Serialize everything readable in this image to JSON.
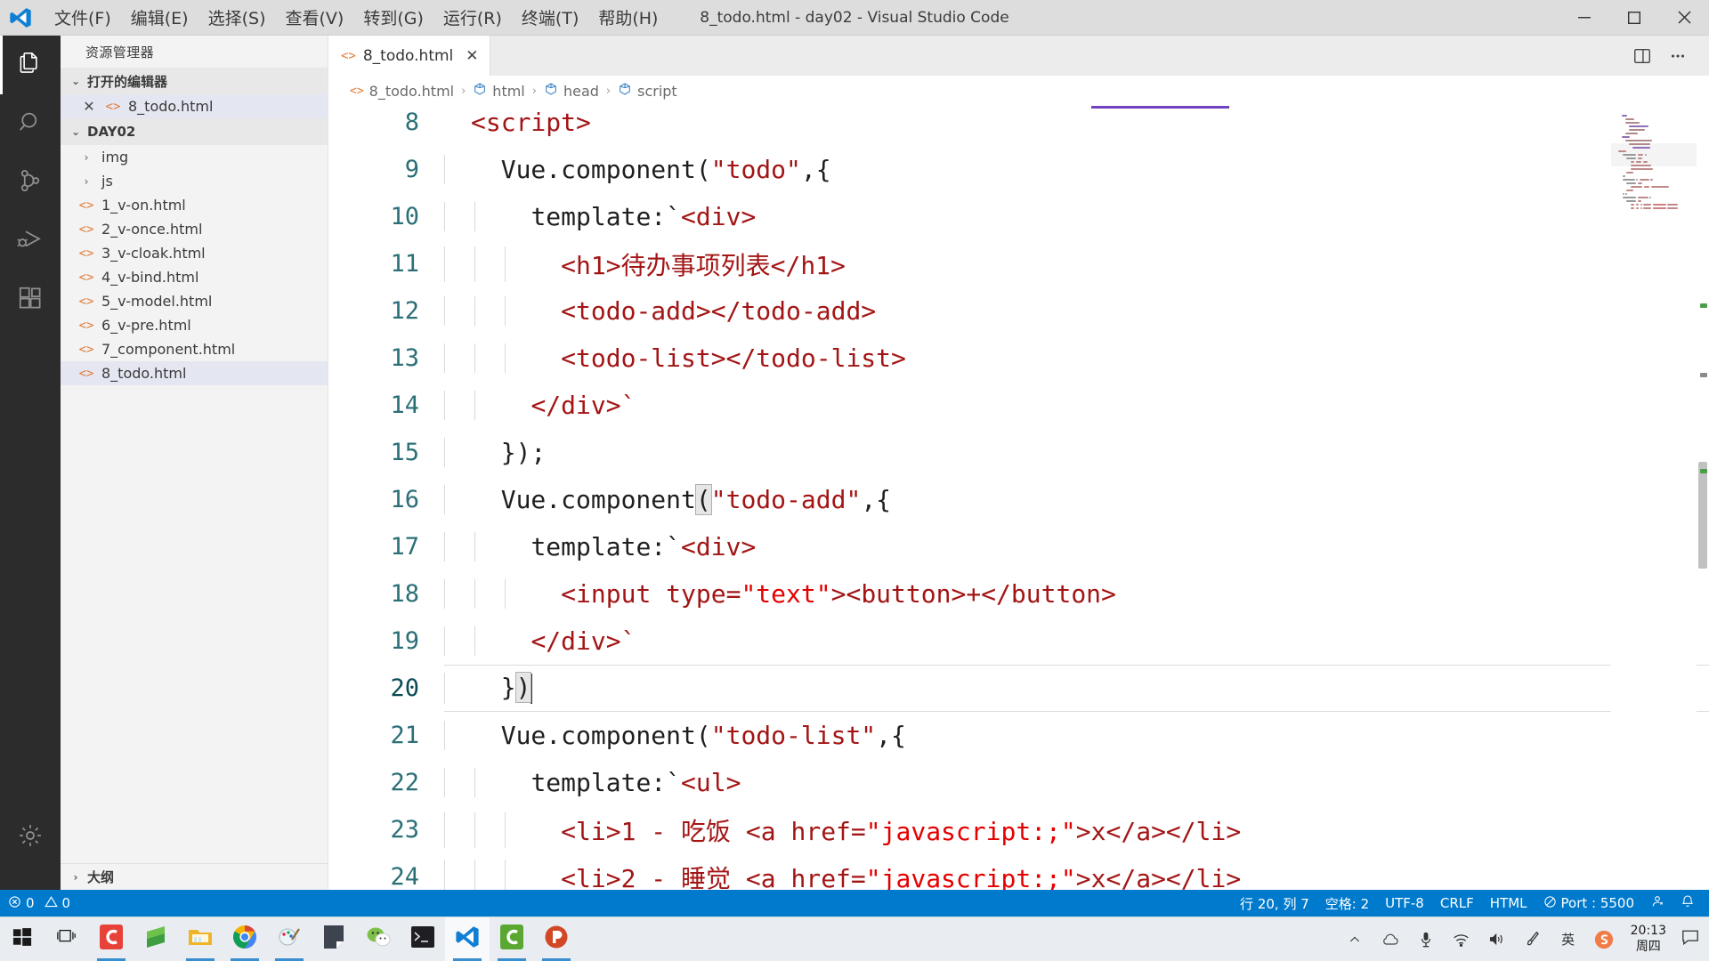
{
  "window": {
    "title": "8_todo.html - day02 - Visual Studio Code",
    "logo": "vscode-logo",
    "menus": [
      {
        "label": "文件(F)",
        "name": "menu-file"
      },
      {
        "label": "编辑(E)",
        "name": "menu-edit"
      },
      {
        "label": "选择(S)",
        "name": "menu-selection"
      },
      {
        "label": "查看(V)",
        "name": "menu-view"
      },
      {
        "label": "转到(G)",
        "name": "menu-go"
      },
      {
        "label": "运行(R)",
        "name": "menu-run"
      },
      {
        "label": "终端(T)",
        "name": "menu-terminal"
      },
      {
        "label": "帮助(H)",
        "name": "menu-help"
      }
    ],
    "controls": {
      "minimize": "—",
      "maximize": "▢",
      "close": "✕"
    }
  },
  "activitybar": {
    "items": [
      {
        "name": "explorer",
        "icon": "files-icon",
        "active": true
      },
      {
        "name": "search",
        "icon": "search-icon",
        "active": false
      },
      {
        "name": "source-control",
        "icon": "source-control-icon",
        "active": false
      },
      {
        "name": "run-debug",
        "icon": "run-and-debug-icon",
        "active": false
      },
      {
        "name": "extensions",
        "icon": "extensions-icon",
        "active": false
      }
    ],
    "manage": {
      "name": "manage",
      "icon": "gear-icon"
    }
  },
  "sidebar": {
    "title": "资源管理器",
    "open_editors": {
      "label": "打开的编辑器",
      "expanded": true,
      "items": [
        {
          "label": "8_todo.html",
          "icon": "html-icon",
          "close": "✕",
          "selected": true
        }
      ]
    },
    "folder": {
      "label": "DAY02",
      "expanded": true,
      "items": [
        {
          "label": "img",
          "type": "folder",
          "expanded": false
        },
        {
          "label": "js",
          "type": "folder",
          "expanded": false
        },
        {
          "label": "1_v-on.html",
          "type": "file",
          "icon": "html-icon"
        },
        {
          "label": "2_v-once.html",
          "type": "file",
          "icon": "html-icon"
        },
        {
          "label": "3_v-cloak.html",
          "type": "file",
          "icon": "html-icon"
        },
        {
          "label": "4_v-bind.html",
          "type": "file",
          "icon": "html-icon"
        },
        {
          "label": "5_v-model.html",
          "type": "file",
          "icon": "html-icon"
        },
        {
          "label": "6_v-pre.html",
          "type": "file",
          "icon": "html-icon"
        },
        {
          "label": "7_component.html",
          "type": "file",
          "icon": "html-icon"
        },
        {
          "label": "8_todo.html",
          "type": "file",
          "icon": "html-icon",
          "selected": true
        }
      ]
    },
    "outline": {
      "label": "大纲",
      "expanded": false
    }
  },
  "editor": {
    "tabs": [
      {
        "label": "8_todo.html",
        "icon": "html-icon",
        "active": true,
        "close": "✕"
      }
    ],
    "tab_actions": [
      {
        "name": "split-editor-right",
        "icon": "split-editor-icon"
      },
      {
        "name": "more-actions",
        "icon": "ellipsis-icon"
      }
    ],
    "breadcrumb": [
      {
        "label": "8_todo.html",
        "icon": "html-icon"
      },
      {
        "label": "html",
        "icon": "symbol-object-icon"
      },
      {
        "label": "head",
        "icon": "symbol-object-icon"
      },
      {
        "label": "script",
        "icon": "symbol-object-icon"
      }
    ],
    "breadcrumb_separator": "›",
    "first_visible_line": 8,
    "cursor": {
      "line": 20,
      "column": 7
    },
    "lines": [
      {
        "no": "8",
        "indent_guides": 0,
        "tokens": [
          {
            "t": "<script>",
            "c": "tag"
          }
        ]
      },
      {
        "no": "9",
        "indent_guides": 1,
        "tokens": [
          {
            "t": "  ",
            "c": "plain"
          },
          {
            "t": "Vue.component(",
            "c": "plain"
          },
          {
            "t": "\"todo\"",
            "c": "str"
          },
          {
            "t": ",{",
            "c": "plain"
          }
        ]
      },
      {
        "no": "10",
        "indent_guides": 2,
        "tokens": [
          {
            "t": "    ",
            "c": "plain"
          },
          {
            "t": "template:`",
            "c": "plain"
          },
          {
            "t": "<div>",
            "c": "tag"
          }
        ]
      },
      {
        "no": "11",
        "indent_guides": 3,
        "tokens": [
          {
            "t": "      ",
            "c": "plain"
          },
          {
            "t": "<h1>",
            "c": "tag"
          },
          {
            "t": "待办事项列表",
            "c": "cjk"
          },
          {
            "t": "</h1>",
            "c": "tag"
          }
        ]
      },
      {
        "no": "12",
        "indent_guides": 3,
        "tokens": [
          {
            "t": "      ",
            "c": "plain"
          },
          {
            "t": "<todo-add></todo-add>",
            "c": "tag"
          }
        ]
      },
      {
        "no": "13",
        "indent_guides": 3,
        "tokens": [
          {
            "t": "      ",
            "c": "plain"
          },
          {
            "t": "<todo-list></todo-list>",
            "c": "tag"
          }
        ]
      },
      {
        "no": "14",
        "indent_guides": 2,
        "tokens": [
          {
            "t": "    ",
            "c": "plain"
          },
          {
            "t": "</div>`",
            "c": "tag"
          }
        ]
      },
      {
        "no": "15",
        "indent_guides": 1,
        "tokens": [
          {
            "t": "  ",
            "c": "plain"
          },
          {
            "t": "});",
            "c": "plain"
          }
        ]
      },
      {
        "no": "16",
        "indent_guides": 1,
        "tokens": [
          {
            "t": "  ",
            "c": "plain"
          },
          {
            "t": "Vue.component",
            "c": "plain"
          },
          {
            "t": "(",
            "c": "bracket"
          },
          {
            "t": "\"todo-add\"",
            "c": "str"
          },
          {
            "t": ",{",
            "c": "plain"
          }
        ]
      },
      {
        "no": "17",
        "indent_guides": 2,
        "tokens": [
          {
            "t": "    ",
            "c": "plain"
          },
          {
            "t": "template:`",
            "c": "plain"
          },
          {
            "t": "<div>",
            "c": "tag"
          }
        ]
      },
      {
        "no": "18",
        "indent_guides": 3,
        "tokens": [
          {
            "t": "      ",
            "c": "plain"
          },
          {
            "t": "<input type=",
            "c": "tag"
          },
          {
            "t": "\"text\"",
            "c": "attr"
          },
          {
            "t": "><button>+</button>",
            "c": "tag"
          }
        ]
      },
      {
        "no": "19",
        "indent_guides": 2,
        "tokens": [
          {
            "t": "    ",
            "c": "plain"
          },
          {
            "t": "</div>`",
            "c": "tag"
          }
        ]
      },
      {
        "no": "20",
        "indent_guides": 1,
        "current": true,
        "tokens": [
          {
            "t": "  ",
            "c": "plain"
          },
          {
            "t": "}",
            "c": "plain"
          },
          {
            "t": ")",
            "c": "bracket"
          },
          {
            "t": "|caret|",
            "c": "caret"
          }
        ]
      },
      {
        "no": "21",
        "indent_guides": 1,
        "tokens": [
          {
            "t": "  ",
            "c": "plain"
          },
          {
            "t": "Vue.component(",
            "c": "plain"
          },
          {
            "t": "\"todo-list\"",
            "c": "str"
          },
          {
            "t": ",{",
            "c": "plain"
          }
        ]
      },
      {
        "no": "22",
        "indent_guides": 2,
        "tokens": [
          {
            "t": "    ",
            "c": "plain"
          },
          {
            "t": "template:`",
            "c": "plain"
          },
          {
            "t": "<ul>",
            "c": "tag"
          }
        ]
      },
      {
        "no": "23",
        "indent_guides": 3,
        "tokens": [
          {
            "t": "      ",
            "c": "plain"
          },
          {
            "t": "<li>",
            "c": "tag"
          },
          {
            "t": "1 - ",
            "c": "tag"
          },
          {
            "t": "吃饭",
            "c": "cjk"
          },
          {
            "t": " <a href=",
            "c": "tag"
          },
          {
            "t": "\"javascript:;\"",
            "c": "attr"
          },
          {
            "t": ">x</a></li>",
            "c": "tag"
          }
        ]
      },
      {
        "no": "24",
        "indent_guides": 3,
        "tokens": [
          {
            "t": "      ",
            "c": "plain"
          },
          {
            "t": "<li>",
            "c": "tag"
          },
          {
            "t": "2 - ",
            "c": "tag"
          },
          {
            "t": "睡觉",
            "c": "cjk"
          },
          {
            "t": " <a href=",
            "c": "tag"
          },
          {
            "t": "\"javascript:;\"",
            "c": "attr"
          },
          {
            "t": ">x</a></li>",
            "c": "tag"
          }
        ]
      }
    ]
  },
  "statusbar": {
    "left": [
      {
        "name": "problems",
        "icon": "error-icon",
        "errors": "0",
        "warn_icon": "warning-icon",
        "warnings": "0"
      }
    ],
    "right": [
      {
        "name": "cursor-position",
        "label": "行 20, 列 7"
      },
      {
        "name": "indentation",
        "label": "空格: 2"
      },
      {
        "name": "encoding",
        "label": "UTF-8"
      },
      {
        "name": "eol",
        "label": "CRLF"
      },
      {
        "name": "language-mode",
        "label": "HTML"
      },
      {
        "name": "live-server-port",
        "label": "Port : 5500",
        "icon": "broadcast-icon"
      },
      {
        "name": "accounts",
        "label": "",
        "icon": "account-icon"
      },
      {
        "name": "notifications",
        "label": "",
        "icon": "bell-icon"
      }
    ]
  },
  "taskbar": {
    "start": {
      "name": "start-button",
      "icon": "windows-icon"
    },
    "task_view": {
      "name": "task-view-button",
      "icon": "task-view-icon"
    },
    "items": [
      {
        "name": "taskbar-app-c",
        "icon": "c-red-icon",
        "running": true
      },
      {
        "name": "taskbar-app-sublime",
        "icon": "sublime-icon",
        "running": false
      },
      {
        "name": "taskbar-file-explorer",
        "icon": "folder-icon",
        "running": true
      },
      {
        "name": "taskbar-chrome",
        "icon": "chrome-icon",
        "running": true
      },
      {
        "name": "taskbar-paint",
        "icon": "paint-icon",
        "running": true
      },
      {
        "name": "taskbar-note",
        "icon": "note-icon",
        "running": false
      },
      {
        "name": "taskbar-wechat",
        "icon": "wechat-icon",
        "running": false
      },
      {
        "name": "taskbar-terminal",
        "icon": "terminal-icon",
        "running": false
      },
      {
        "name": "taskbar-vscode",
        "icon": "vscode-icon",
        "running": true,
        "active": true
      },
      {
        "name": "taskbar-c-green",
        "icon": "c-green-icon",
        "running": true
      },
      {
        "name": "taskbar-powerpoint",
        "icon": "powerpoint-icon",
        "running": true
      }
    ],
    "tray": [
      {
        "name": "show-hidden-icons",
        "icon": "chevron-up-icon"
      },
      {
        "name": "onedrive",
        "icon": "cloud-icon"
      },
      {
        "name": "microphone",
        "icon": "microphone-icon"
      },
      {
        "name": "network",
        "icon": "wifi-icon"
      },
      {
        "name": "volume",
        "icon": "speaker-icon"
      },
      {
        "name": "pen",
        "icon": "pen-icon"
      },
      {
        "name": "ime-english",
        "icon": "ime-icon"
      },
      {
        "name": "sogou-input",
        "icon": "sogou-icon"
      }
    ],
    "clock": {
      "time": "20:13",
      "date": "周四"
    },
    "notification": {
      "name": "action-center",
      "icon": "speech-bubble-icon"
    }
  },
  "colors": {
    "accent": "#007acc",
    "titlebar_bg": "#dddddd",
    "sidebar_bg": "#f3f3f3",
    "activitybar_bg": "#2c2c2c",
    "editor_bg": "#ffffff",
    "tag_color": "#a31515",
    "string_color": "#a31515",
    "lineno_color": "#2b6f77",
    "breadcrumb_underline": "#6f42c1"
  }
}
